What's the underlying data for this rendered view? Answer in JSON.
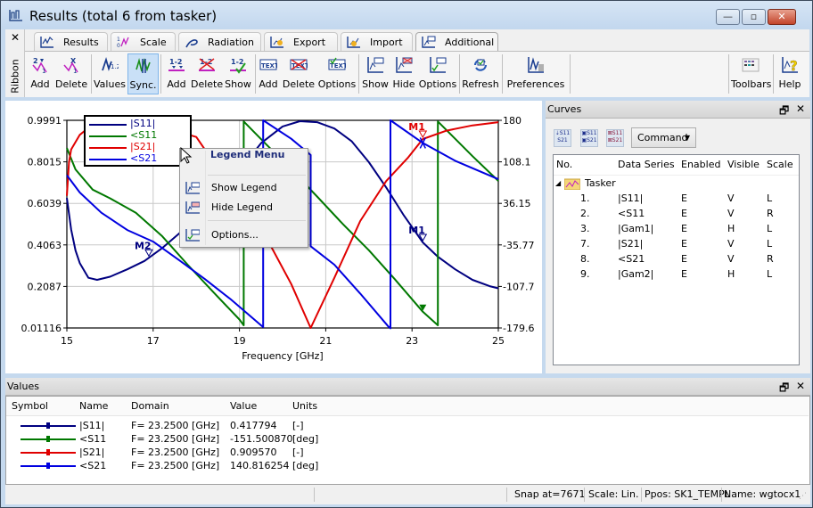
{
  "window": {
    "title": "Results (total 6 from tasker)",
    "controls": {
      "minimize": "—",
      "maximize": "▫",
      "close": "✕"
    }
  },
  "ribbon": {
    "side_label": "Ribbon",
    "close_glyph": "✕",
    "tabs": [
      {
        "label": "Results",
        "icon": "results-chart-icon"
      },
      {
        "label": "Scale",
        "icon": "scale-icon"
      },
      {
        "label": "Radiation",
        "icon": "radiation-icon"
      },
      {
        "label": "Export",
        "icon": "export-icon"
      },
      {
        "label": "Import",
        "icon": "import-icon"
      },
      {
        "label": "Additional",
        "icon": "additional-icon",
        "active": true
      }
    ],
    "buttons": [
      {
        "label": "Add",
        "icon": "add-marker-icon"
      },
      {
        "label": "Delete",
        "icon": "delete-marker-icon"
      },
      {
        "label": "Values",
        "icon": "values-icon"
      },
      {
        "label": "Sync.",
        "icon": "sync-icon",
        "selected": true
      },
      {
        "label": "Add",
        "icon": "add-delta-marker-icon"
      },
      {
        "label": "Delete",
        "icon": "delete-delta-marker-icon"
      },
      {
        "label": "Show",
        "icon": "show-delta-marker-icon"
      },
      {
        "label": "Add",
        "icon": "add-text-icon"
      },
      {
        "label": "Delete",
        "icon": "delete-text-icon"
      },
      {
        "label": "Options",
        "icon": "text-options-icon"
      },
      {
        "label": "Show",
        "icon": "show-legend-icon"
      },
      {
        "label": "Hide",
        "icon": "hide-legend-icon"
      },
      {
        "label": "Options",
        "icon": "legend-options-icon"
      },
      {
        "label": "Refresh",
        "icon": "refresh-icon"
      },
      {
        "label": "Preferences",
        "icon": "preferences-icon"
      },
      {
        "label": "Toolbars",
        "icon": "toolbars-icon"
      },
      {
        "label": "Help",
        "icon": "help-icon"
      }
    ]
  },
  "chart_data": {
    "type": "line",
    "title": "",
    "xlabel": "Frequency [GHz]",
    "ylabel_left": "",
    "ylabel_right": "",
    "xlim": [
      15,
      25
    ],
    "ylim_left": [
      0.01116,
      0.9991
    ],
    "ylim_right": [
      -179.6,
      180
    ],
    "x_ticks": [
      "15",
      "17",
      "19",
      "21",
      "23",
      "25"
    ],
    "y_ticks_left": [
      "0.9991",
      "0.8015",
      "0.6039",
      "0.4063",
      "0.2087",
      "0.01116"
    ],
    "y_ticks_right": [
      "180",
      "108.1",
      "36.15",
      "-35.77",
      "-107.7",
      "-179.6"
    ],
    "grid": true,
    "legend": {
      "position": "top-left",
      "entries": [
        "|S11|",
        "<S11",
        "|S21|",
        "<S21"
      ]
    },
    "series": [
      {
        "name": "|S11|",
        "axis": "left",
        "color": "#000080",
        "x": [
          15.0,
          15.1,
          15.2,
          15.3,
          15.5,
          15.7,
          16.0,
          16.4,
          16.8,
          17.2,
          17.6,
          18.0,
          18.5,
          19.0,
          19.5,
          20.0,
          20.4,
          20.8,
          21.2,
          21.6,
          22.0,
          22.4,
          22.8,
          23.25,
          23.6,
          24.0,
          24.4,
          24.8,
          25.0
        ],
        "y": [
          0.63,
          0.48,
          0.38,
          0.32,
          0.25,
          0.24,
          0.255,
          0.29,
          0.33,
          0.39,
          0.46,
          0.54,
          0.64,
          0.76,
          0.89,
          0.97,
          0.995,
          0.99,
          0.96,
          0.9,
          0.8,
          0.68,
          0.55,
          0.418,
          0.35,
          0.29,
          0.24,
          0.21,
          0.2
        ]
      },
      {
        "name": "<S11",
        "axis": "right",
        "color": "#007800",
        "x": [
          15.0,
          15.2,
          15.6,
          16.0,
          16.6,
          17.2,
          17.8,
          18.4,
          19.0,
          19.1,
          19.1,
          19.6,
          20.2,
          20.8,
          21.4,
          22.0,
          22.6,
          23.25,
          23.6,
          23.6,
          24.4,
          25.0
        ],
        "y": [
          132,
          95,
          60,
          45,
          20,
          -20,
          -70,
          -118,
          -165,
          -175,
          178,
          140,
          95,
          48,
          0,
          -45,
          -95,
          -151.5,
          -175,
          178,
          118,
          75
        ]
      },
      {
        "name": "|S21|",
        "axis": "left",
        "color": "#e00000",
        "x": [
          15.0,
          15.05,
          15.1,
          15.3,
          15.6,
          16.0,
          17.0,
          18.0,
          19.0,
          19.6,
          20.2,
          20.65,
          21.2,
          21.8,
          22.4,
          22.9,
          23.25,
          23.8,
          24.4,
          25.0
        ],
        "y": [
          0.64,
          0.8,
          0.86,
          0.93,
          0.98,
          0.99,
          0.98,
          0.92,
          0.62,
          0.45,
          0.22,
          0.011,
          0.25,
          0.52,
          0.71,
          0.82,
          0.91,
          0.95,
          0.975,
          0.99
        ]
      },
      {
        "name": "<S21",
        "axis": "right",
        "color": "#0000e0",
        "x": [
          15.0,
          15.3,
          15.8,
          16.4,
          17.0,
          17.6,
          18.2,
          18.8,
          19.5,
          19.55,
          19.55,
          20.2,
          20.65,
          20.65,
          21.2,
          21.8,
          22.45,
          22.5,
          22.5,
          23.25,
          24.0,
          25.0
        ],
        "y": [
          85,
          55,
          20,
          -10,
          -30,
          -62,
          -95,
          -130,
          -175,
          -178,
          180,
          148,
          120,
          -38,
          -70,
          -120,
          -177,
          -180,
          180,
          140.8,
          110,
          78
        ]
      }
    ],
    "markers": [
      {
        "label": "M1",
        "series": "|S11|",
        "x": 23.25,
        "color": "#000080"
      },
      {
        "label": "M1",
        "series": "|S21|",
        "x": 23.25,
        "color": "#e00000"
      },
      {
        "label": "M2",
        "series": "|S11|",
        "x": 16.9,
        "color": "#000080"
      }
    ]
  },
  "legend_menu": {
    "title": "Legend Menu",
    "items": [
      {
        "label": "Show Legend",
        "icon": "show-legend-icon"
      },
      {
        "label": "Hide Legend",
        "icon": "hide-legend-icon"
      },
      {
        "label": "Options...",
        "icon": "legend-options-icon"
      }
    ]
  },
  "curves_panel": {
    "title": "Curves",
    "float_glyph": "🗗",
    "close_glyph": "✕",
    "toolbar_buttons": [
      {
        "label": "S11\nS21",
        "icon": "sort-series-icon"
      },
      {
        "label": "S11\nS21",
        "icon": "enable-all-icon"
      },
      {
        "label": "S11\nS21",
        "icon": "disable-all-icon"
      }
    ],
    "command_label": "Command",
    "columns": [
      "No.",
      "Data Series",
      "Enabled",
      "Visible",
      "Scale"
    ],
    "group": "Tasker",
    "rows": [
      {
        "no": "1.",
        "series": "|S11|",
        "enabled": "E",
        "visible": "V",
        "scale": "L"
      },
      {
        "no": "2.",
        "series": "<S11",
        "enabled": "E",
        "visible": "V",
        "scale": "R"
      },
      {
        "no": "3.",
        "series": "|Gam1|",
        "enabled": "E",
        "visible": "H",
        "scale": "L"
      },
      {
        "no": "7.",
        "series": "|S21|",
        "enabled": "E",
        "visible": "V",
        "scale": "L"
      },
      {
        "no": "8.",
        "series": "<S21",
        "enabled": "E",
        "visible": "V",
        "scale": "R"
      },
      {
        "no": "9.",
        "series": "|Gam2|",
        "enabled": "E",
        "visible": "H",
        "scale": "L"
      }
    ]
  },
  "values_panel": {
    "title": "Values",
    "columns": [
      "Symbol",
      "Name",
      "Domain",
      "Value",
      "Units"
    ],
    "rows": [
      {
        "color": "#000080",
        "name": "|S11|",
        "domain": "F= 23.2500 [GHz]",
        "value": "0.417794",
        "units": "[-]"
      },
      {
        "color": "#007800",
        "name": "<S11",
        "domain": "F= 23.2500 [GHz]",
        "value": "-151.500870",
        "units": "[deg]"
      },
      {
        "color": "#e00000",
        "name": "|S21|",
        "domain": "F= 23.2500 [GHz]",
        "value": "0.909570",
        "units": "[-]"
      },
      {
        "color": "#0000e0",
        "name": "<S21",
        "domain": "F= 23.2500 [GHz]",
        "value": "140.816254",
        "units": "[deg]"
      }
    ]
  },
  "status_bar": {
    "snap": "Snap at=7671",
    "scale": "Scale: Lin.",
    "ppos": "Ppos: SK1_TEMPL",
    "name": "Name: wgtocx1"
  }
}
